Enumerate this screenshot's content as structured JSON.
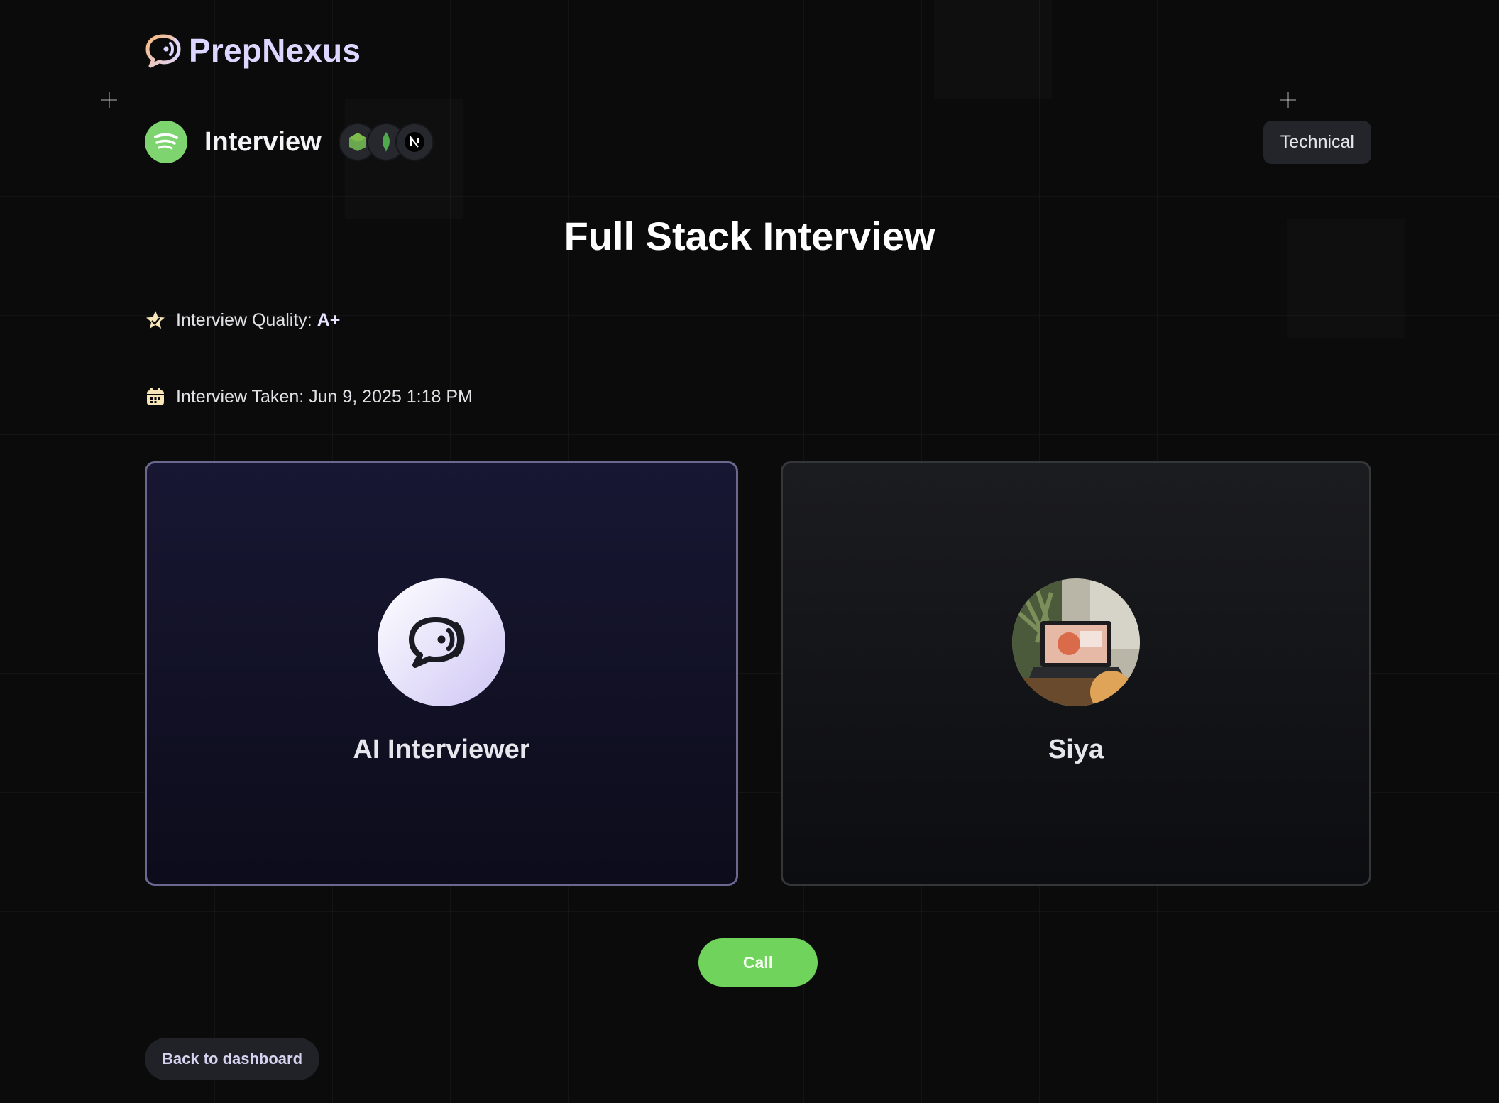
{
  "brand": {
    "name": "PrepNexus"
  },
  "header": {
    "role": "Interview",
    "tech_stack": [
      "node-js-icon",
      "mongodb-icon",
      "next-js-icon"
    ],
    "badge": "Technical"
  },
  "title": "Full Stack Interview",
  "quality": {
    "label": "Interview Quality: ",
    "value": "A+"
  },
  "taken": {
    "label": "Interview Taken: Jun 9, 2025 1:18 PM"
  },
  "cards": {
    "ai": {
      "name": "AI Interviewer"
    },
    "user": {
      "name": "Siya"
    }
  },
  "actions": {
    "call": "Call",
    "back": "Back to dashboard"
  },
  "colors": {
    "accent": "#7ed56f",
    "brand_text": "#ddd6ff",
    "ai_card_border": "#6b6890"
  }
}
